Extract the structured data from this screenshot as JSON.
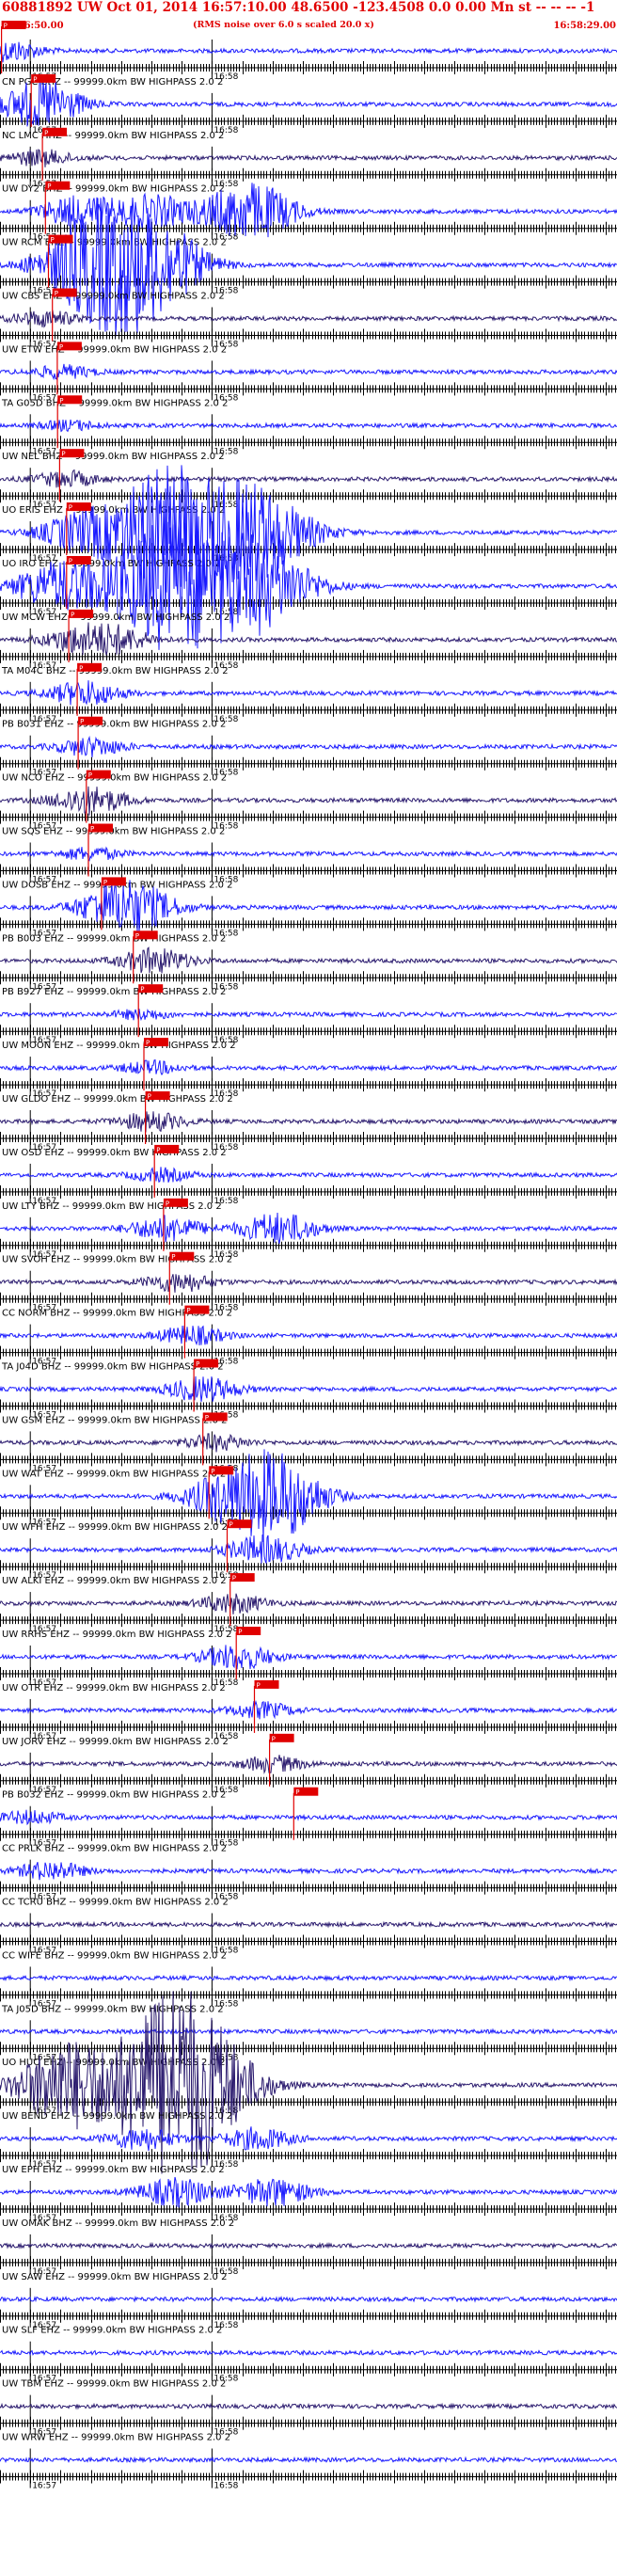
{
  "header": {
    "title": "60881892 UW Oct 01, 2014 16:57:10.00   48.6500  -123.4508  0.0 0.00 Mn st -- -- --  -1",
    "start_time": "16:56:50.00",
    "note": "(RMS noise over 6.0 s scaled 20.0 x)",
    "end_time": "16:58:29.00"
  },
  "chart_data": {
    "type": "line",
    "title": "60881892 UW Oct 01, 2014 16:57:10.00   48.6500  -123.4508  0.0 0.00 Mn st -- -- --  -1",
    "x_range": [
      "16:56:50.00",
      "16:58:29.00"
    ],
    "tick_labels": [
      "16:57",
      "16:58"
    ],
    "trace_colors": {
      "primary": "#1a1aff",
      "alternate": "#2a1a6e",
      "pick": "#e00000"
    },
    "traces": [
      {
        "label": "",
        "pick": "P",
        "pick_time": "16:56:50.5",
        "env": [
          {
            "t": "16:56:51.0",
            "a": 0.3
          },
          {
            "t": "16:56:55.0",
            "a": 0.4
          }
        ]
      },
      {
        "label": "CN PGC BHZ -- 99999.0km BW  HIGHPASS  2.0  2",
        "pick": "P",
        "pick_time": "16:57:00.3",
        "env": [
          {
            "t": "16:57:03.2",
            "a": 1.2
          },
          {
            "t": "16:57:05.3",
            "a": 0.5
          }
        ]
      },
      {
        "label": "NC LMC HHZ -- 99999.0km BW  HIGHPASS  2.0  2",
        "pick": "P",
        "pick_time": "16:57:04.0",
        "env": [
          {
            "t": "16:57:03.2",
            "a": 0.5
          }
        ]
      },
      {
        "label": "UW DY2 BHZ -- 99999.0km BW  HIGHPASS  2.0  2",
        "pick": "P",
        "pick_time": "16:57:05.0",
        "env": [
          {
            "t": "16:57:16.0",
            "a": 1.0
          },
          {
            "t": "16:57:40.0",
            "a": 1.0
          },
          {
            "t": "16:58:08.0",
            "a": 1.3
          },
          {
            "t": "16:58:18.0",
            "a": 0.9
          }
        ]
      },
      {
        "label": "UW RCM EHZ -- 99999.0km BW  HIGHPASS  2.0  2",
        "pick": "P",
        "pick_time": "16:57:06.0",
        "env": [
          {
            "t": "16:57:17.0",
            "a": 1.5
          },
          {
            "t": "16:57:23.0",
            "a": 1.5
          },
          {
            "t": "16:57:30.0",
            "a": 1.4
          },
          {
            "t": "16:57:38.0",
            "a": 1.5
          },
          {
            "t": "16:57:46.0",
            "a": 1.3
          }
        ]
      },
      {
        "label": "UW CBS EHZ -- 99999.0km BW  HIGHPASS  2.0  2",
        "pick": "P",
        "pick_time": "16:57:07.3",
        "env": [
          {
            "t": "16:57:05.0",
            "a": 0.5
          }
        ]
      },
      {
        "label": "UW ETW EHZ -- 99999.0km BW  HIGHPASS  2.0  2",
        "pick": "P",
        "pick_time": "16:57:08.9",
        "env": [
          {
            "t": "16:57:11.0",
            "a": 0.4
          }
        ]
      },
      {
        "label": "TA G05D BHZ -- 99999.0km BW  HIGHPASS  2.0  2",
        "pick": "P",
        "pick_time": "16:57:09.0",
        "env": [
          {
            "t": "16:57:13.0",
            "a": 0.3
          }
        ]
      },
      {
        "label": "UW NEL BHZ -- 99999.0km BW  HIGHPASS  2.0  2",
        "pick": "P",
        "pick_time": "16:57:09.7",
        "env": [
          {
            "t": "16:57:12.0",
            "a": 0.5
          }
        ]
      },
      {
        "label": "UO ERIS EHZ -- 99999.0km BW  HIGHPASS  2.0  2",
        "pick": "P",
        "pick_time": "16:57:12.0",
        "env": [
          {
            "t": "16:57:17.0",
            "a": 1.2
          },
          {
            "t": "16:57:42.0",
            "a": 2.0
          },
          {
            "t": "16:57:47.0",
            "a": 2.0
          },
          {
            "t": "16:58:05.0",
            "a": 2.0
          },
          {
            "t": "16:58:19.0",
            "a": 1.8
          }
        ]
      },
      {
        "label": "UO IRO EHZ -- 99999.0km BW  HIGHPASS  2.0  2",
        "pick": "P",
        "pick_time": "16:57:12.0",
        "env": [
          {
            "t": "16:57:05.0",
            "a": 1.0
          },
          {
            "t": "16:57:17.0",
            "a": 1.0
          },
          {
            "t": "16:57:42.0",
            "a": 2.0
          },
          {
            "t": "16:57:47.0",
            "a": 2.0
          },
          {
            "t": "16:58:05.0",
            "a": 2.0
          },
          {
            "t": "16:58:19.0",
            "a": 1.8
          }
        ]
      },
      {
        "label": "UW MCW EHZ -- 99999.0km BW  HIGHPASS  2.0  2",
        "pick": "P",
        "pick_time": "16:57:12.7",
        "env": [
          {
            "t": "16:57:14.0",
            "a": 0.6
          },
          {
            "t": "16:57:27.0",
            "a": 0.9
          }
        ]
      },
      {
        "label": "TA M04C BHZ -- 99999.0km BW  HIGHPASS  2.0  2",
        "pick": "P",
        "pick_time": "16:57:15.5",
        "env": [
          {
            "t": "16:57:18.0",
            "a": 0.8
          }
        ]
      },
      {
        "label": "PB B031 EHZ -- 99999.0km BW  HIGHPASS  2.0  2",
        "pick": "P",
        "pick_time": "16:57:15.8",
        "env": [
          {
            "t": "16:57:20.0",
            "a": 0.6
          }
        ]
      },
      {
        "label": "UW NCO EHZ -- 99999.0km BW  HIGHPASS  2.0  2",
        "pick": "P",
        "pick_time": "16:57:18.5",
        "env": [
          {
            "t": "16:57:19.5",
            "a": 0.9
          }
        ]
      },
      {
        "label": "UW SQS EHZ -- 99999.0km BW  HIGHPASS  2.0  2",
        "pick": "P",
        "pick_time": "16:57:19.2",
        "env": [
          {
            "t": "16:57:20.0",
            "a": 0.4
          }
        ]
      },
      {
        "label": "UW DOSB EHZ -- 99999.0km BW  HIGHPASS  2.0  2",
        "pick": "P",
        "pick_time": "16:57:23.5",
        "env": [
          {
            "t": "16:57:27.0",
            "a": 1.0
          },
          {
            "t": "16:57:36.0",
            "a": 1.1
          }
        ]
      },
      {
        "label": "PB B003 EHZ -- 99999.0km BW  HIGHPASS  2.0  2",
        "pick": "P",
        "pick_time": "16:57:34.0",
        "env": [
          {
            "t": "16:57:41.0",
            "a": 0.8
          }
        ]
      },
      {
        "label": "PB B927 EHZ -- 99999.0km BW  HIGHPASS  2.0  2",
        "pick": "P",
        "pick_time": "16:57:35.7",
        "env": [
          {
            "t": "16:57:37.0",
            "a": 0.3
          }
        ]
      },
      {
        "label": "UW MOON EHZ -- 99999.0km BW  HIGHPASS  2.0  2",
        "pick": "P",
        "pick_time": "16:57:37.5",
        "env": [
          {
            "t": "16:57:40.0",
            "a": 0.4
          }
        ]
      },
      {
        "label": "UW GLDO EHZ -- 99999.0km BW  HIGHPASS  2.0  2",
        "pick": "P",
        "pick_time": "16:57:38.0",
        "env": [
          {
            "t": "16:57:40.0",
            "a": 0.6
          }
        ]
      },
      {
        "label": "UW OSD EHZ -- 99999.0km BW  HIGHPASS  2.0  2",
        "pick": "P",
        "pick_time": "16:57:41.0",
        "env": [
          {
            "t": "16:57:43.0",
            "a": 0.4
          }
        ]
      },
      {
        "label": "UW LTY BHZ -- 99999.0km BW  HIGHPASS  2.0  2",
        "pick": "P",
        "pick_time": "16:57:44.0",
        "env": [
          {
            "t": "16:57:45.0",
            "a": 0.8
          },
          {
            "t": "16:58:22.0",
            "a": 1.0
          }
        ]
      },
      {
        "label": "UW SVOH EHZ -- 99999.0km BW  HIGHPASS  2.0  2",
        "pick": "P",
        "pick_time": "16:57:46.0",
        "env": [
          {
            "t": "16:57:49.0",
            "a": 0.6
          }
        ]
      },
      {
        "label": "CC NORM BHZ -- 99999.0km BW  HIGHPASS  2.0  2",
        "pick": "P",
        "pick_time": "16:57:51.0",
        "env": [
          {
            "t": "16:57:53.0",
            "a": 0.6
          }
        ]
      },
      {
        "label": "TA J04D BHZ -- 99999.0km BW  HIGHPASS  2.0  2",
        "pick": "P",
        "pick_time": "16:57:54.0",
        "env": [
          {
            "t": "16:57:57.0",
            "a": 0.8
          }
        ]
      },
      {
        "label": "UW GSM EHZ -- 99999.0km BW  HIGHPASS  2.0  2",
        "pick": "P",
        "pick_time": "16:57:57.0",
        "env": [
          {
            "t": "16:58:01.0",
            "a": 0.5
          }
        ]
      },
      {
        "label": "UW WAT EHZ -- 99999.0km BW  HIGHPASS  2.0  2",
        "pick": "P",
        "pick_time": "16:57:59.0",
        "env": [
          {
            "t": "16:58:08.0",
            "a": 1.6
          },
          {
            "t": "16:58:20.0",
            "a": 1.5
          },
          {
            "t": "16:58:27.0",
            "a": 0.9
          }
        ]
      },
      {
        "label": "UW WFH EHZ -- 99999.0km BW  HIGHPASS  2.0  2",
        "pick": "P",
        "pick_time": "16:58:05.0",
        "env": [
          {
            "t": "16:58:17.0",
            "a": 0.9
          }
        ]
      },
      {
        "label": "UW ALKI EHZ -- 99999.0km BW  HIGHPASS  2.0  2",
        "pick": "P",
        "pick_time": "16:58:06.0",
        "env": [
          {
            "t": "16:58:07.0",
            "a": 0.6
          }
        ]
      },
      {
        "label": "UW RRHS EHZ -- 99999.0km BW  HIGHPASS  2.0  2",
        "pick": "P",
        "pick_time": "16:58:08.0",
        "env": [
          {
            "t": "16:58:08.5",
            "a": 0.8
          }
        ]
      },
      {
        "label": "UW OTR EHZ -- 99999.0km BW  HIGHPASS  2.0  2",
        "pick": "P",
        "pick_time": "16:58:14.0",
        "env": [
          {
            "t": "16:58:16.0",
            "a": 0.5
          }
        ]
      },
      {
        "label": "UW JORV EHZ -- 99999.0km BW  HIGHPASS  2.0  2",
        "pick": "P",
        "pick_time": "16:58:19.0",
        "env": [
          {
            "t": "16:58:20.0",
            "a": 0.5
          }
        ]
      },
      {
        "label": "PB B032 EHZ -- 99999.0km BW  HIGHPASS  2.0  2",
        "pick": "P",
        "pick_time": "16:58:27.0",
        "env": [
          {
            "t": "16:57:00.0",
            "a": 0.4
          }
        ]
      },
      {
        "label": "CC PRLK BHZ -- 99999.0km BW  HIGHPASS  2.0  2",
        "pick": "",
        "pick_time": "",
        "env": [
          {
            "t": "16:57:07.0",
            "a": 0.6
          }
        ]
      },
      {
        "label": "CC TCRU BHZ -- 99999.0km BW  HIGHPASS  2.0  2",
        "pick": "",
        "pick_time": "",
        "env": []
      },
      {
        "label": "CC WIFE BHZ -- 99999.0km BW  HIGHPASS  2.0  2",
        "pick": "",
        "pick_time": "",
        "env": []
      },
      {
        "label": "TA J05D BHZ -- 99999.0km BW  HIGHPASS  2.0  2",
        "pick": "",
        "pick_time": "",
        "env": []
      },
      {
        "label": "UO HUO EHZ -- 99999.0km BW  HIGHPASS  2.0  2",
        "pick": "",
        "pick_time": "",
        "env": [
          {
            "t": "16:57:09.0",
            "a": 1.5
          },
          {
            "t": "16:57:15.0",
            "a": 1.5
          },
          {
            "t": "16:57:42.0",
            "a": 2.0
          },
          {
            "t": "16:57:46.0",
            "a": 2.0
          },
          {
            "t": "16:57:50.0",
            "a": 2.0
          },
          {
            "t": "16:58:01.0",
            "a": 1.8
          }
        ]
      },
      {
        "label": "UW BEND EHZ -- 99999.0km BW  HIGHPASS  2.0  2",
        "pick": "",
        "pick_time": "",
        "env": [
          {
            "t": "16:57:37.0",
            "a": 0.7
          },
          {
            "t": "16:58:15.0",
            "a": 0.7
          }
        ]
      },
      {
        "label": "UW EPH EHZ -- 99999.0km BW  HIGHPASS  2.0  2",
        "pick": "",
        "pick_time": "",
        "env": [
          {
            "t": "16:57:48.0",
            "a": 0.9
          },
          {
            "t": "16:58:20.0",
            "a": 0.9
          }
        ]
      },
      {
        "label": "UW OMAK BHZ -- 99999.0km BW  HIGHPASS  2.0  2",
        "pick": "",
        "pick_time": "",
        "env": []
      },
      {
        "label": "UW SAW EHZ -- 99999.0km BW  HIGHPASS  2.0  2",
        "pick": "",
        "pick_time": "",
        "env": []
      },
      {
        "label": "UW SLF EHZ -- 99999.0km BW  HIGHPASS  2.0  2",
        "pick": "",
        "pick_time": "",
        "env": []
      },
      {
        "label": "UW TBM EHZ -- 99999.0km BW  HIGHPASS  2.0  2",
        "pick": "",
        "pick_time": "",
        "env": []
      },
      {
        "label": "UW WRW EHZ -- 99999.0km BW  HIGHPASS  2.0  2",
        "pick": "",
        "pick_time": "",
        "env": []
      }
    ]
  }
}
